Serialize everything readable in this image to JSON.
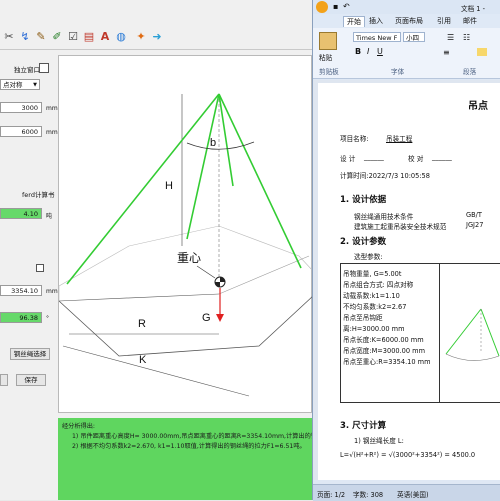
{
  "left_app": {
    "toolbar_icons": [
      "scissors-icon",
      "curve-icon",
      "pen-icon",
      "ruler-icon",
      "checklist-icon",
      "pdf-icon",
      "font-icon",
      "globe-icon",
      "star-icon",
      "arrow-icon"
    ],
    "panel": {
      "independent_window_label": "独立窗口",
      "sling_combo_value": "点对称",
      "input1_value": "3000",
      "input1_unit": "mm",
      "input2_value": "6000",
      "input2_unit": "mm",
      "calc_book_label": "ferd计算书",
      "green1_value": "4.10",
      "green1_unit": "吨",
      "input3_value": "3354.10",
      "input3_unit": "mm",
      "green2_value": "96.38",
      "green2_unit": "°",
      "wire_select_button": "钢丝绳选择",
      "save_button": "保存"
    },
    "diagram_labels": {
      "b": "b",
      "H": "H",
      "center": "重心",
      "G": "G",
      "R": "R",
      "K": "K"
    },
    "result_lines": [
      "经分析得出:",
      "1) 吊件距离重心高度H= 3000.00mm,吊点距离重心的距离R=3354.10mm,计算出的钢丝绳长",
      "2) 根据不均匀系数k2=2.670, k1=1.10取值,计算得出的钢丝绳的拉力F1=6.51吨。"
    ]
  },
  "word": {
    "title": "文档 1 -",
    "ribbon_tabs": [
      "开始",
      "插入",
      "页面布局",
      "引用",
      "邮件"
    ],
    "font_name": "Times New F",
    "font_size": "小四",
    "paste_label": "粘贴",
    "group_labels": [
      "剪贴板",
      "字体",
      "段落"
    ],
    "doc": {
      "heading": "吊点",
      "project_label": "项目名称:",
      "project_name": "吊装工程",
      "design_label": "设 计",
      "check_label": "校 对",
      "calc_time": "计算时间:2022/7/3 10:05:58",
      "sec1": "1. 设计依据",
      "basis1": "钢丝绳通用技术条件",
      "basis1_code": "GB/T",
      "basis2": "建筑施工起重吊装安全技术规范",
      "basis2_code": "JGJ27",
      "sec2": "2. 设计参数",
      "diagram_caption": "选型参数:",
      "params": [
        "吊物重量, G=5.00t",
        "吊点组合方式: 四点对称",
        "动载系数:k1=1.10",
        "不均匀系数:k2=2.67",
        "吊点至吊钩距",
        "离:H=3000.00 mm",
        "吊点长度:K=6000.00 mm",
        "吊点宽度:M=3000.00 mm",
        "吊点至重心:R=3354.10 mm"
      ],
      "sec3": "3. 尺寸计算",
      "calc1": "1) 钢丝绳长度 L:",
      "formula": "L=√(H²+R²) = √(3000²+3354²) = 4500.0"
    },
    "status": {
      "page": "页面: 1/2",
      "words": "字数: 308",
      "lang": "英语(美国)"
    }
  }
}
